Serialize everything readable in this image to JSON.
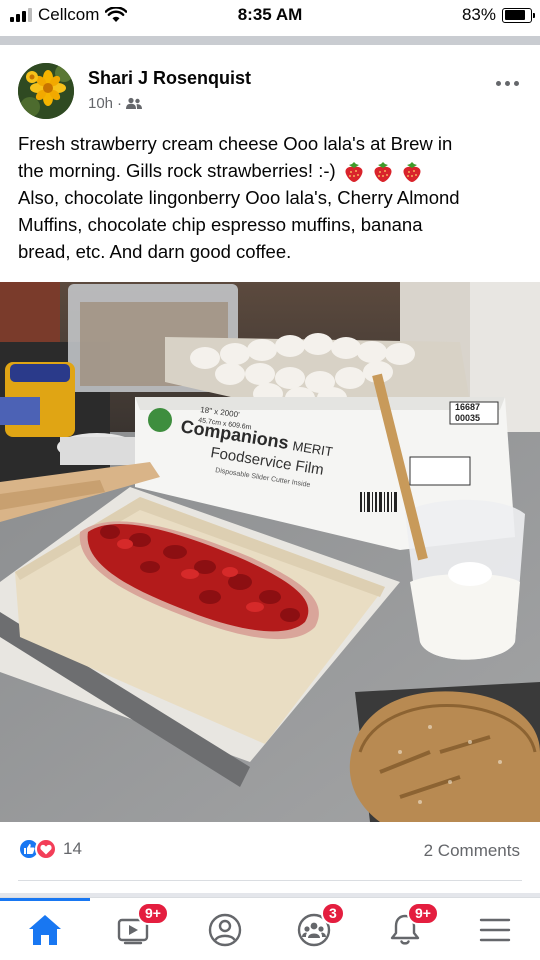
{
  "status_bar": {
    "carrier": "Cellcom",
    "time": "8:35 AM",
    "battery_percent": "83%",
    "battery_level": 0.83
  },
  "post": {
    "author": "Shari J Rosenquist",
    "time_ago": "10h",
    "separator": "·",
    "audience_icon": "friends-icon",
    "text_lines": [
      "Fresh strawberry cream cheese Ooo lala's at Brew in",
      "the morning. Gills rock strawberries! :-)",
      "Also, chocolate lingonberry Ooo lala's, Cherry Almond",
      "Muffins, chocolate chip espresso muffins, banana",
      "bread, etc.  And darn good coffee."
    ],
    "emoji": [
      "strawberry-icon",
      "strawberry-icon",
      "strawberry-icon"
    ],
    "photo_box_text": {
      "size_line": "18\" x 2000'",
      "metric_line": "45.7cm x 609.6m",
      "brand": "Companions",
      "brand_suffix": "MERIT",
      "product": "Foodservice Film",
      "subtitle": "Disposable Slider Cutter Inside",
      "code": "16687",
      "code2": "00035"
    },
    "reaction_count": "14",
    "reaction_types": [
      "like",
      "love"
    ],
    "comments": "2 Comments"
  },
  "nav": {
    "items": [
      {
        "name": "home",
        "icon": "home-icon",
        "active": true
      },
      {
        "name": "watch",
        "icon": "video-icon",
        "badge": "9+"
      },
      {
        "name": "profile",
        "icon": "profile-icon"
      },
      {
        "name": "groups",
        "icon": "groups-icon",
        "badge": "3"
      },
      {
        "name": "notifications",
        "icon": "bell-icon",
        "badge": "9+"
      },
      {
        "name": "menu",
        "icon": "menu-icon"
      }
    ]
  },
  "colors": {
    "accent": "#1877f2",
    "badge": "#e41e3f",
    "secondary_text": "#65676b"
  }
}
